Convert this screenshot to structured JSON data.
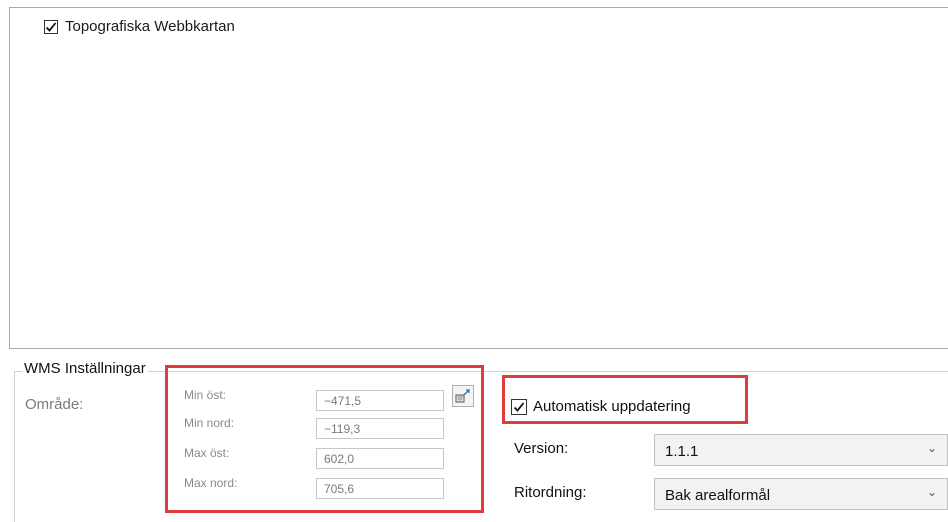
{
  "layers": [
    {
      "label": "Topografiska Webbkartan",
      "checked": true
    }
  ],
  "wms": {
    "group_title": "WMS Inställningar",
    "area_label": "Område:",
    "coords": {
      "min_ost_label": "Min öst:",
      "min_ost_value": "−471,5",
      "min_nord_label": "Min nord:",
      "min_nord_value": "−119,3",
      "max_ost_label": "Max öst:",
      "max_ost_value": "602,0",
      "max_nord_label": "Max nord:",
      "max_nord_value": "705,6"
    },
    "auto_update": {
      "label": "Automatisk uppdatering",
      "checked": true
    },
    "version": {
      "label": "Version:",
      "value": "1.1.1"
    },
    "draw_order": {
      "label": "Ritordning:",
      "value": "Bak arealformål"
    }
  },
  "colors": {
    "highlight": "#e03c3c"
  },
  "icons": {
    "pick_area": "pick-from-map-icon",
    "dropdown": "chevron-down-icon"
  }
}
